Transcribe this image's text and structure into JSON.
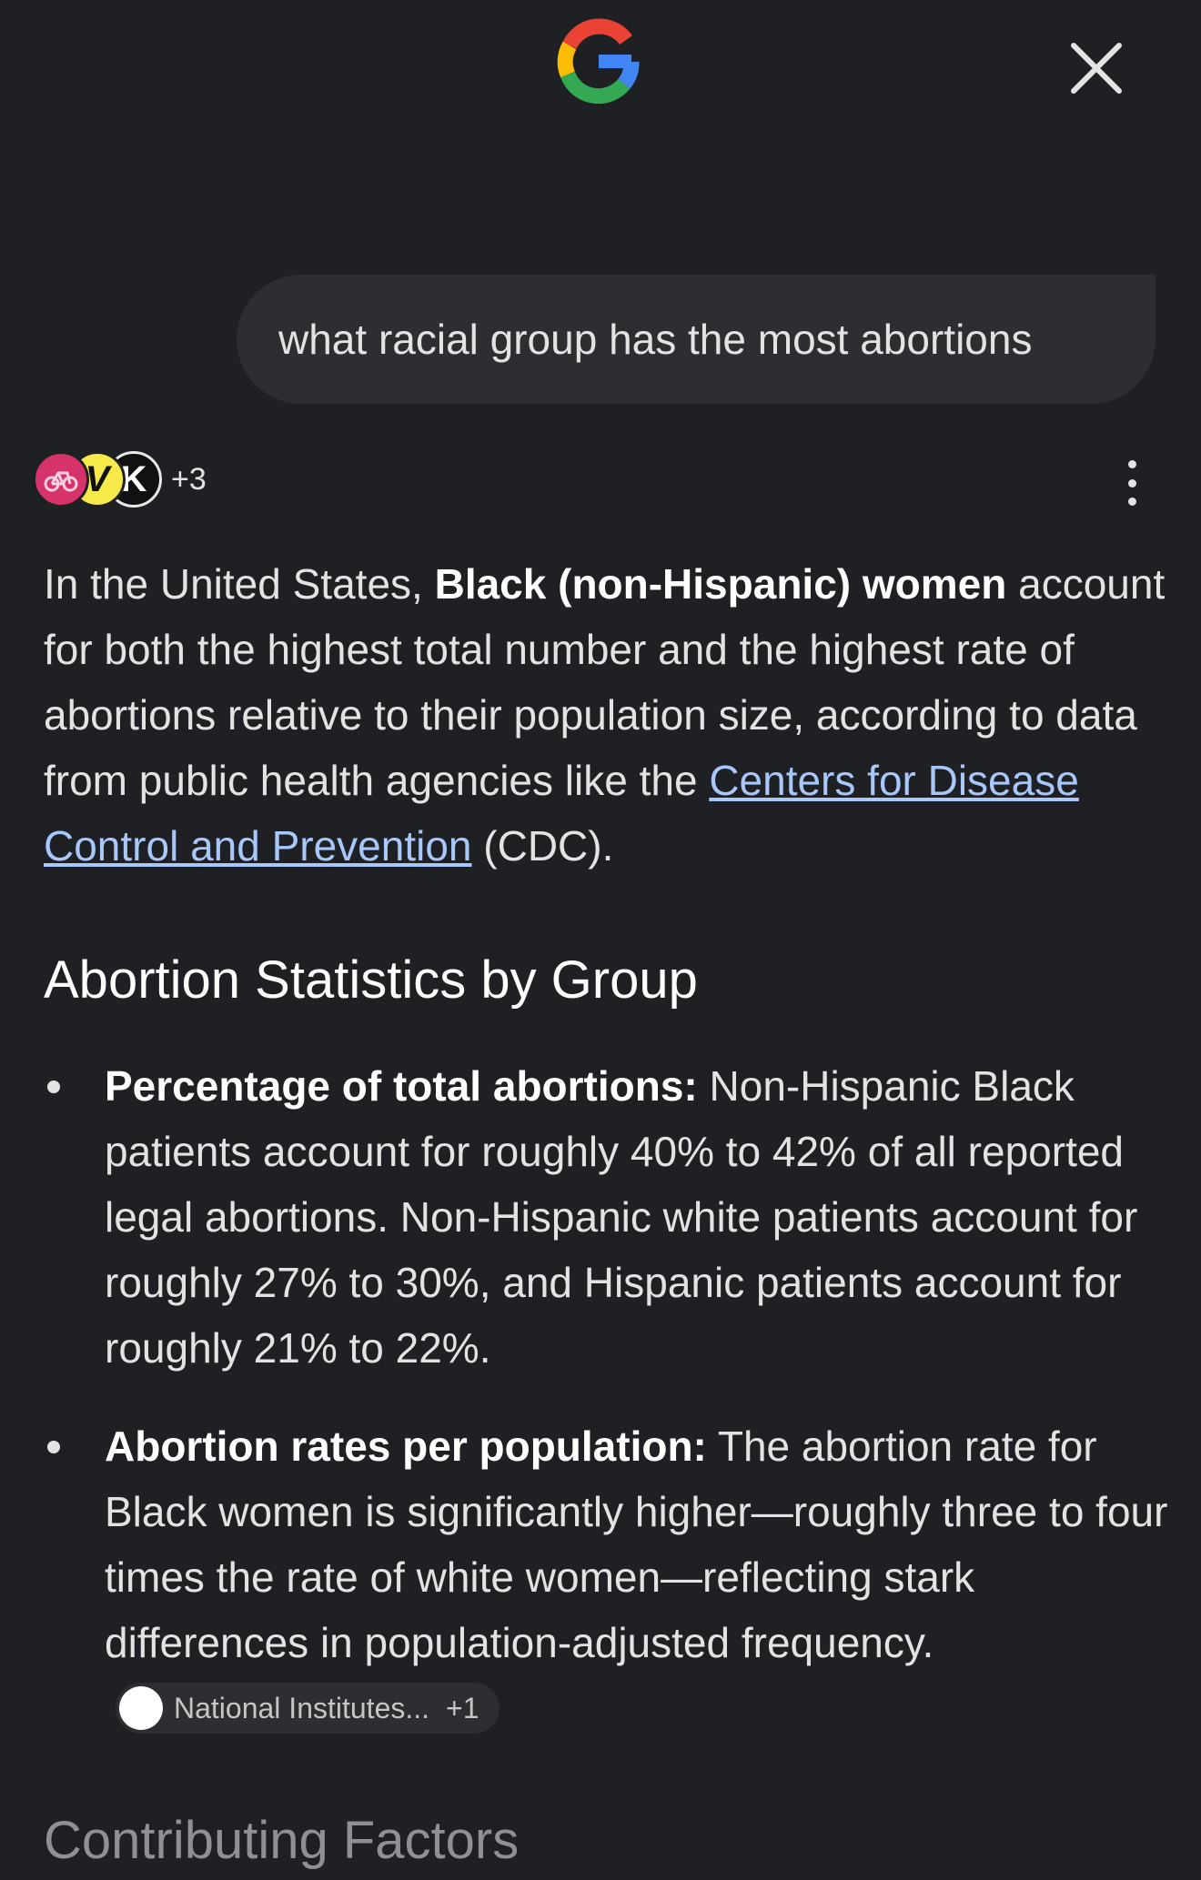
{
  "header": {
    "logo_letter": "G",
    "close_icon": "close-icon"
  },
  "query": {
    "text": "what racial group has the most abortions"
  },
  "sources": {
    "avatar_1_icon": "bike-logo",
    "avatar_2_letter": "V",
    "avatar_3_letter": "K",
    "more_count": "+3",
    "menu_icon": "more-vert-icon"
  },
  "answer": {
    "part1": "In the United States, ",
    "bold1": "Black (non-Hispanic) women",
    "part2": " account for both the highest total number and the highest rate of abortions relative to their population size, according to data from public health agencies like the ",
    "link": "Centers for Disease Control and Prevention",
    "part3": " (CDC)."
  },
  "section": {
    "heading": "Abortion Statistics by Group",
    "bullets": [
      {
        "title": "Percentage of total abortions:",
        "text": " Non-Hispanic Black patients account for roughly 40% to 42% of all reported legal abortions. Non-Hispanic white patients account for roughly 27% to 30%, and Hispanic patients account for roughly 21% to 22%."
      },
      {
        "title": "Abortion rates per population:",
        "text": " The abortion rate for Black women is significantly higher—roughly three to four times the rate of white women—reflecting stark differences in population-adjusted frequency.",
        "chip_label": "National Institutes...",
        "chip_count": "+1"
      }
    ]
  },
  "next_section": {
    "heading": "Contributing Factors"
  },
  "colors": {
    "background": "#1f2023",
    "bubble": "#2d2e31",
    "link": "#a8c7fa",
    "text": "#e3e3e3"
  }
}
